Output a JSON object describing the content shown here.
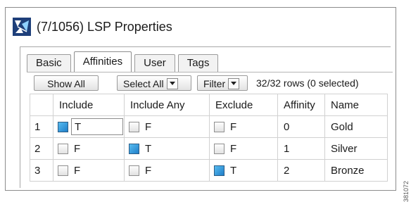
{
  "window": {
    "title": "(7/1056) LSP Properties",
    "icon": "lsp-network-icon"
  },
  "tabs": [
    {
      "label": "Basic",
      "active": false
    },
    {
      "label": "Affinities",
      "active": true
    },
    {
      "label": "User",
      "active": false
    },
    {
      "label": "Tags",
      "active": false
    }
  ],
  "toolbar": {
    "show_all": "Show All",
    "select_all": "Select All",
    "filter": "Filter",
    "row_count": "32/32 rows (0 selected)"
  },
  "table": {
    "columns": [
      "",
      "Include",
      "Include Any",
      "Exclude",
      "Affinity",
      "Name"
    ],
    "rows": [
      {
        "num": "1",
        "include": "T",
        "include_any": "F",
        "exclude": "F",
        "affinity": "0",
        "name": "Gold"
      },
      {
        "num": "2",
        "include": "F",
        "include_any": "T",
        "exclude": "F",
        "affinity": "1",
        "name": "Silver"
      },
      {
        "num": "3",
        "include": "F",
        "include_any": "F",
        "exclude": "T",
        "affinity": "2",
        "name": "Bronze"
      }
    ]
  },
  "figure_id": "381072",
  "colors": {
    "checked": "#1f7ec8",
    "border": "#8c8c8c"
  }
}
